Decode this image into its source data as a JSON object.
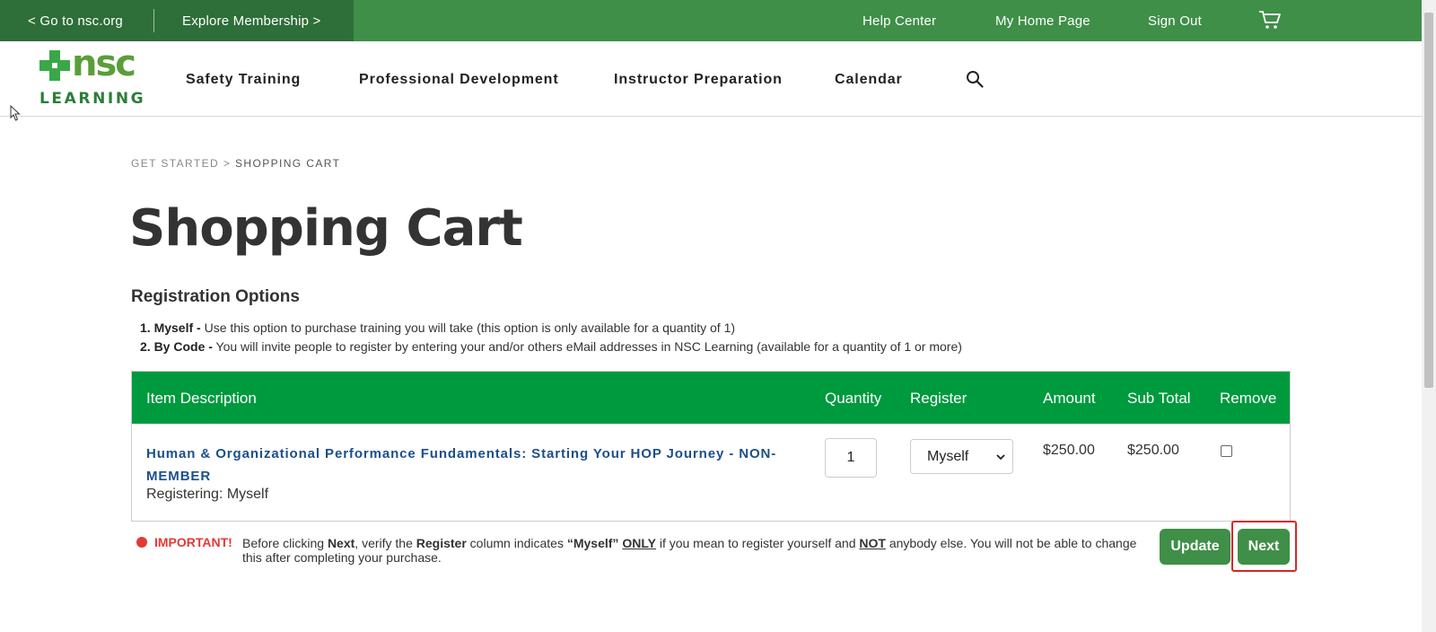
{
  "topbar": {
    "go_to_nsc": "< Go to nsc.org",
    "explore_membership": "Explore Membership >",
    "help_center": "Help Center",
    "my_home_page": "My Home Page",
    "sign_out": "Sign Out",
    "cart_icon": "cart-icon"
  },
  "logo": {
    "brand": "nsc",
    "tagline": "LEARNING"
  },
  "nav": {
    "items": [
      "Safety Training",
      "Professional Development",
      "Instructor Preparation",
      "Calendar"
    ],
    "search_icon": "search-icon"
  },
  "breadcrumb": {
    "parent": "GET STARTED",
    "separator": ">",
    "current": "SHOPPING CART"
  },
  "page": {
    "title": "Shopping Cart"
  },
  "registration": {
    "title": "Registration Options",
    "options": [
      {
        "label": "1. Myself -",
        "text": " Use this option to purchase training you will take (this option is only available for a quantity of 1)"
      },
      {
        "label": "2. By Code -",
        "text": " You will invite people to register by entering your and/or others eMail addresses in NSC Learning (available for a quantity of 1 or more)"
      }
    ]
  },
  "cart": {
    "columns": {
      "item": "Item Description",
      "quantity": "Quantity",
      "register": "Register",
      "amount": "Amount",
      "subtotal": "Sub Total",
      "remove": "Remove"
    },
    "rows": [
      {
        "title": "Human & Organizational Performance Fundamentals: Starting Your HOP Journey - NON-MEMBER",
        "registering": "Registering: Myself",
        "quantity": "1",
        "register": "Myself",
        "amount": "$250.00",
        "subtotal": "$250.00",
        "remove_checked": false
      }
    ]
  },
  "notice": {
    "important": "IMPORTANT!",
    "t1": "Before clicking ",
    "b1": "Next",
    "t2": ", verify the ",
    "b2": "Register",
    "t3": " column indicates ",
    "b3": "“Myself”",
    "t4": " ",
    "u1": "ONLY",
    "t5": " if you mean to register yourself and ",
    "u2": "NOT",
    "t6": " anybody else. You will not be able to change this after completing your purchase."
  },
  "buttons": {
    "update": "Update",
    "next": "Next"
  },
  "colors": {
    "topbar": "#3f8f48",
    "topbar_dark": "#2e6e38",
    "table_header": "#009a3e",
    "link": "#1c4f8a",
    "important": "#e53935",
    "highlight": "#d62828"
  }
}
